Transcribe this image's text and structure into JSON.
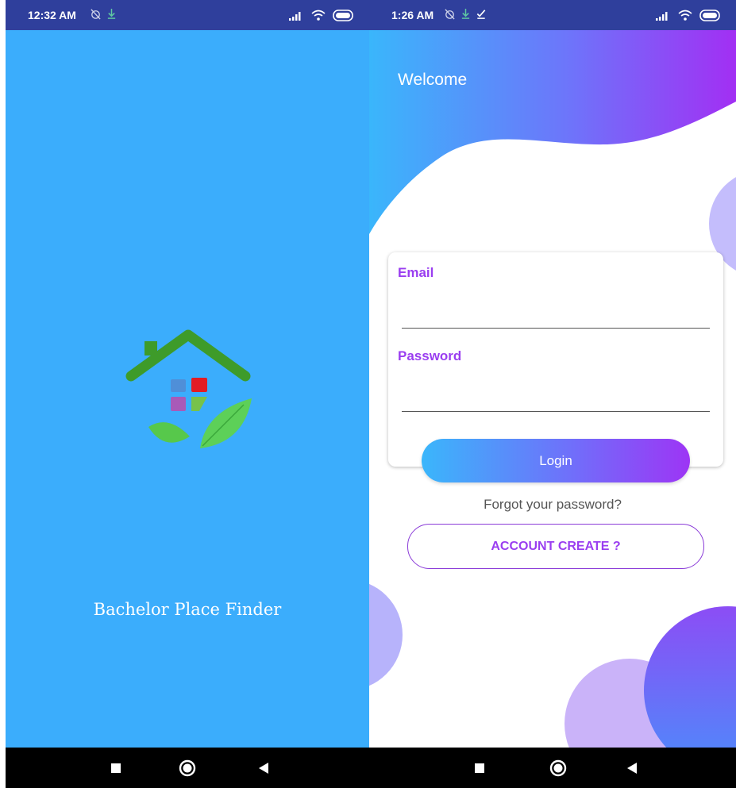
{
  "splash": {
    "status": {
      "time": "12:32 AM"
    },
    "title": "Bachelor Place Finder"
  },
  "login": {
    "status": {
      "time": "1:26 AM"
    },
    "welcome": "Welcome",
    "email_label": "Email",
    "email_value": "",
    "password_label": "Password",
    "password_value": "",
    "login_label": "Login",
    "forgot_label": "Forgot your password?",
    "create_label": "ACCOUNT CREATE ?"
  },
  "colors": {
    "splash_bg": "#3badfc",
    "status_bar": "#2f3f9c",
    "accent_purple": "#9a3ef0",
    "gradient_start": "#3ab6fb",
    "gradient_end": "#9d35f5"
  },
  "icons": [
    "alarm-off-icon",
    "download-icon",
    "check-icon",
    "signal-icon",
    "wifi-icon",
    "battery-icon",
    "recents-icon",
    "home-icon",
    "back-icon",
    "house-leaf-logo"
  ]
}
